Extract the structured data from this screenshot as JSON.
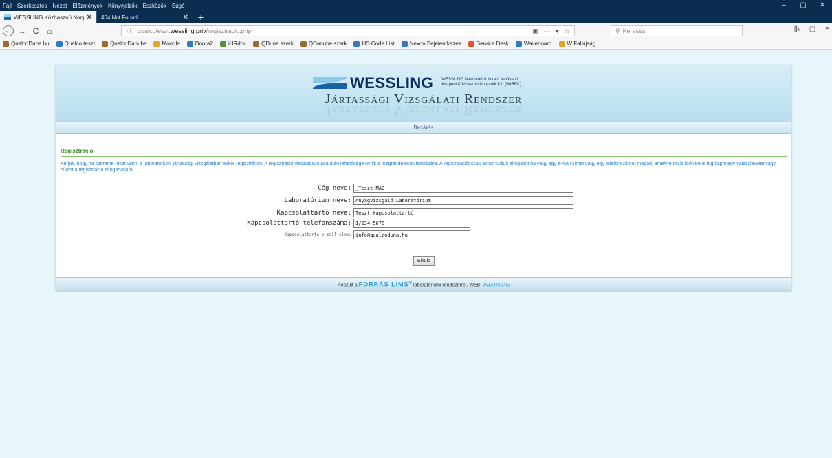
{
  "menubar": {
    "items": [
      "Fájl",
      "Szerkesztés",
      "Nézet",
      "Előzmények",
      "Könyvjelzők",
      "Eszközök",
      "Súgó"
    ],
    "window_controls": [
      "–",
      "▢",
      "✕"
    ]
  },
  "tabs": [
    {
      "label": "WESSLING Közhasznú Nonprofi",
      "close": "✕"
    },
    {
      "label": "404 Not Found",
      "close": "✕"
    }
  ],
  "newtab": "+",
  "nav": {
    "back": "←",
    "forward": "→",
    "reload": "C",
    "home": "⌂",
    "url_prefix": "qualcoteszt.",
    "url_host": "wessling.priv",
    "url_path": "/regisztracio.php",
    "url_actions": [
      "▣",
      "···",
      "♥",
      "☆"
    ],
    "search_placeholder": "Keresés",
    "right_tools": [
      "|||\\",
      "▢",
      "≡"
    ]
  },
  "bookmarks": [
    {
      "label": "QualcoDuna.hu",
      "color": "#9a6b2f"
    },
    {
      "label": "Qualco teszt",
      "color": "#2e7bc4"
    },
    {
      "label": "QualcoDanube",
      "color": "#9a6b2f"
    },
    {
      "label": "Moodle",
      "color": "#e2a12a"
    },
    {
      "label": "Doora2",
      "color": "#2e7bc4"
    },
    {
      "label": "iHRdoc",
      "color": "#5a8e3a"
    },
    {
      "label": "QDuna szerk",
      "color": "#9a6b2f"
    },
    {
      "label": "QDanube szerk",
      "color": "#9a6b2f"
    },
    {
      "label": "HS Code List",
      "color": "#2e7bc4"
    },
    {
      "label": "Nexon Bejelentkezés",
      "color": "#2e7bc4"
    },
    {
      "label": "Service Desk",
      "color": "#e2552a"
    },
    {
      "label": "Waveboard",
      "color": "#2e7bc4"
    },
    {
      "label": "W Faliújság",
      "color": "#e2a12a"
    }
  ],
  "banner": {
    "logo_text": "WESSLING",
    "logo_sub_1": "WESSLING Nemzetközi Kutató és Oktató",
    "logo_sub_2": "Központ Közhasznú Nonprofit Kft. (WIREC)",
    "system_title": "Jártassági Vizsgálati Rendszer"
  },
  "closebar_label": "Bezárás",
  "section_title": "Regisztráció",
  "intro_text": "Kérjük, hogy ha szeretne részt venni a laboratóriumi jártassági vizsgálatban akkor regisztráljon. A regisztráció visszaigazolása után lehetősége nyílik a megrendelések leadására. A regisztrációt csak akkor tudjuk elfogadni ha vagy egy e-mail címet vagy egy telefonszámot megad, amelyre rövid időn belül fog kapni egy válaszlevelet vagy hívást a regisztráció elfogadásáról.",
  "form": {
    "company_label": "Cég neve:",
    "company_value": "_Teszt MAE",
    "lab_label": "Laboratórium neve:",
    "lab_value": "Anyagvizsgáló Laboratórium",
    "contact_label": "Kapcsolattartó neve:",
    "contact_value": "Teszt Kapcsolattartó",
    "phone_label": "Kapcsolattartó telefonszáma:",
    "phone_value": "1/234-5678",
    "email_label": "Kapcsolattartó e-mail címe:",
    "email_value": "info@qualcoduna.hu",
    "submit_label": "Elküld"
  },
  "footer": {
    "prefix": "Készült a ",
    "brand": "FORRÁS LIMS",
    "reg": "®",
    "middle": " laboratóriumi rendszerrel.   WEB: ",
    "web": "www.lims.hu"
  }
}
